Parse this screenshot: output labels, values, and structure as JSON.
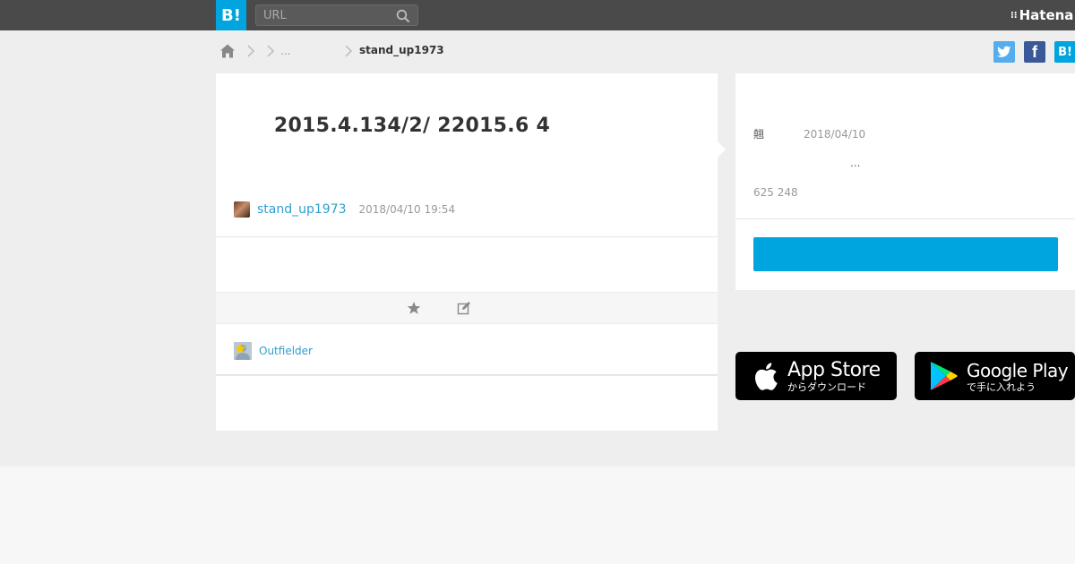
{
  "header": {
    "logo_text": "B!",
    "search_placeholder": "URL",
    "brand_name": "Hatena",
    "brand_mark": "⁝⁝"
  },
  "breadcrumb": {
    "ellipsis": "...",
    "current": "stand_up1973"
  },
  "share": {
    "twitter_label": "t",
    "facebook_label": "f",
    "hatena_label": "B!"
  },
  "entry": {
    "title": "2015.4.134/2/ 22015.6 4",
    "user": "stand_up1973",
    "datetime": "2018/04/10 19:54",
    "starrer": "Outfielder"
  },
  "side": {
    "kanji": "翹",
    "date": "2018/04/10",
    "ellipsis": "...",
    "counts": "625 248"
  },
  "app_badges": {
    "apple_main": "App Store",
    "apple_sub": "からダウンロード",
    "google_main": "Google Play",
    "google_sub": "で手に入れよう"
  },
  "colors": {
    "topbar": "#4a4a4a",
    "accent": "#00a4de",
    "link": "#2e9fd0",
    "twitter": "#55acee",
    "facebook": "#3b5998"
  }
}
